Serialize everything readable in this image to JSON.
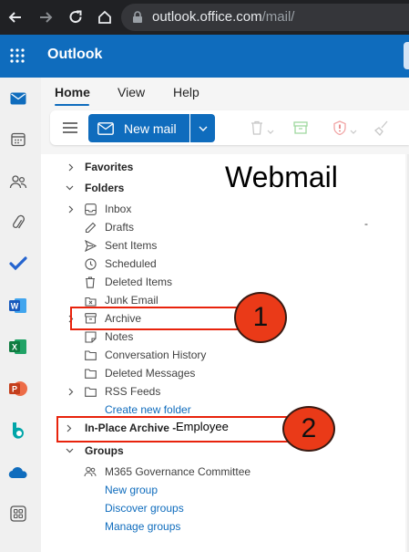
{
  "browser": {
    "url_host": "outlook.office.com",
    "url_path": "/mail/"
  },
  "app": {
    "title": "Outlook"
  },
  "ribbon": {
    "tabs": [
      {
        "label": "Home",
        "active": true
      },
      {
        "label": "View"
      },
      {
        "label": "Help"
      }
    ],
    "new_mail_label": "New mail"
  },
  "folders": {
    "favorites": "Favorites",
    "folders_header": "Folders",
    "items": [
      {
        "label": "Inbox",
        "icon": "inbox-icon",
        "expandable": true
      },
      {
        "label": "Drafts",
        "icon": "pencil-icon"
      },
      {
        "label": "Sent Items",
        "icon": "send-icon"
      },
      {
        "label": "Scheduled",
        "icon": "clock-icon"
      },
      {
        "label": "Deleted Items",
        "icon": "trash-icon"
      },
      {
        "label": "Junk Email",
        "icon": "junk-icon"
      },
      {
        "label": "Archive",
        "icon": "archive-icon",
        "expandable": true
      },
      {
        "label": "Notes",
        "icon": "note-icon"
      },
      {
        "label": "Conversation History",
        "icon": "folder-icon"
      },
      {
        "label": "Deleted Messages",
        "icon": "folder-icon"
      },
      {
        "label": "RSS Feeds",
        "icon": "folder-icon",
        "expandable": true
      }
    ],
    "create_new_folder": "Create new folder",
    "in_place_archive": "In-Place Archive -",
    "groups_header": "Groups",
    "group_item": "M365 Governance Committee",
    "group_links": [
      "New group",
      "Discover groups",
      "Manage groups"
    ]
  },
  "annotations": {
    "webmail": "Webmail",
    "dash": "-",
    "marker_1": "1",
    "marker_2": "2",
    "employee": "Employee",
    "color": "#e8230c"
  },
  "colors": {
    "brand": "#0f6cbd",
    "browser_bg": "#202124"
  }
}
